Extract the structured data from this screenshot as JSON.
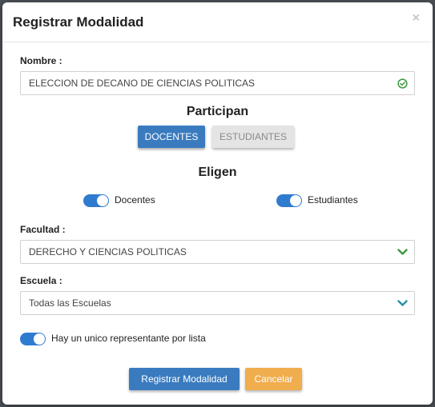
{
  "modal": {
    "title": "Registrar Modalidad",
    "close_label": "×"
  },
  "nombre": {
    "label": "Nombre :",
    "value": "ELECCION DE DECANO DE CIENCIAS POLITICAS"
  },
  "participan": {
    "heading": "Participan",
    "options": [
      "DOCENTES",
      "ESTUDIANTES"
    ],
    "selected": "DOCENTES"
  },
  "eligen": {
    "heading": "Eligen",
    "toggles": [
      {
        "label": "Docentes",
        "on": true
      },
      {
        "label": "Estudiantes",
        "on": true
      }
    ]
  },
  "facultad": {
    "label": "Facultad :",
    "value": "DERECHO Y CIENCIAS POLITICAS"
  },
  "escuela": {
    "label": "Escuela :",
    "value": "Todas las Escuelas"
  },
  "representante": {
    "label": "Hay un unico representante por lista",
    "on": true
  },
  "actions": {
    "submit_label": "Registrar Modalidad",
    "cancel_label": "Cancelar"
  },
  "colors": {
    "primary": "#3a7bbf",
    "warning": "#f0ad4e",
    "toggle": "#2f7bd0",
    "valid": "#3c9a3c",
    "chevron_green": "#3c9a3c",
    "chevron_teal": "#2a8fa8"
  },
  "icons": {
    "nombre_status": "check-circle-icon",
    "facultad_dropdown": "chevron-down-icon",
    "escuela_dropdown": "chevron-down-icon"
  }
}
